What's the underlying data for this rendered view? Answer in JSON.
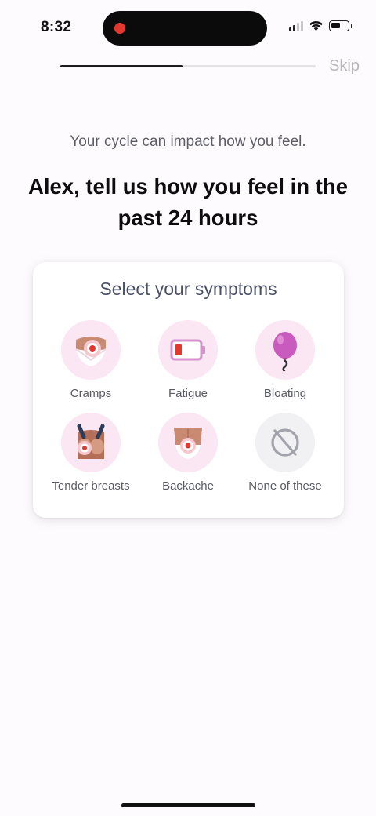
{
  "status_bar": {
    "time": "8:32"
  },
  "progress": {
    "fraction": 0.48
  },
  "header": {
    "skip_label": "Skip"
  },
  "intro": {
    "subtitle": "Your cycle can impact how you feel.",
    "headline_line1": "Alex, tell us how you feel in the",
    "headline_line2": "past 24 hours"
  },
  "symptoms_card": {
    "title": "Select your symptoms",
    "items": [
      {
        "label": "Cramps",
        "icon": "cramps-icon"
      },
      {
        "label": "Fatigue",
        "icon": "low-battery-icon"
      },
      {
        "label": "Bloating",
        "icon": "balloon-icon"
      },
      {
        "label": "Tender breasts",
        "icon": "tender-breasts-icon"
      },
      {
        "label": "Backache",
        "icon": "backache-icon"
      },
      {
        "label": "None of these",
        "icon": "none-icon"
      }
    ]
  },
  "colors": {
    "icon_bg_pink": "#fbe6f3",
    "icon_bg_grey": "#f1f1f3",
    "accent_red": "#e2382d",
    "balloon": "#c95bbe"
  }
}
